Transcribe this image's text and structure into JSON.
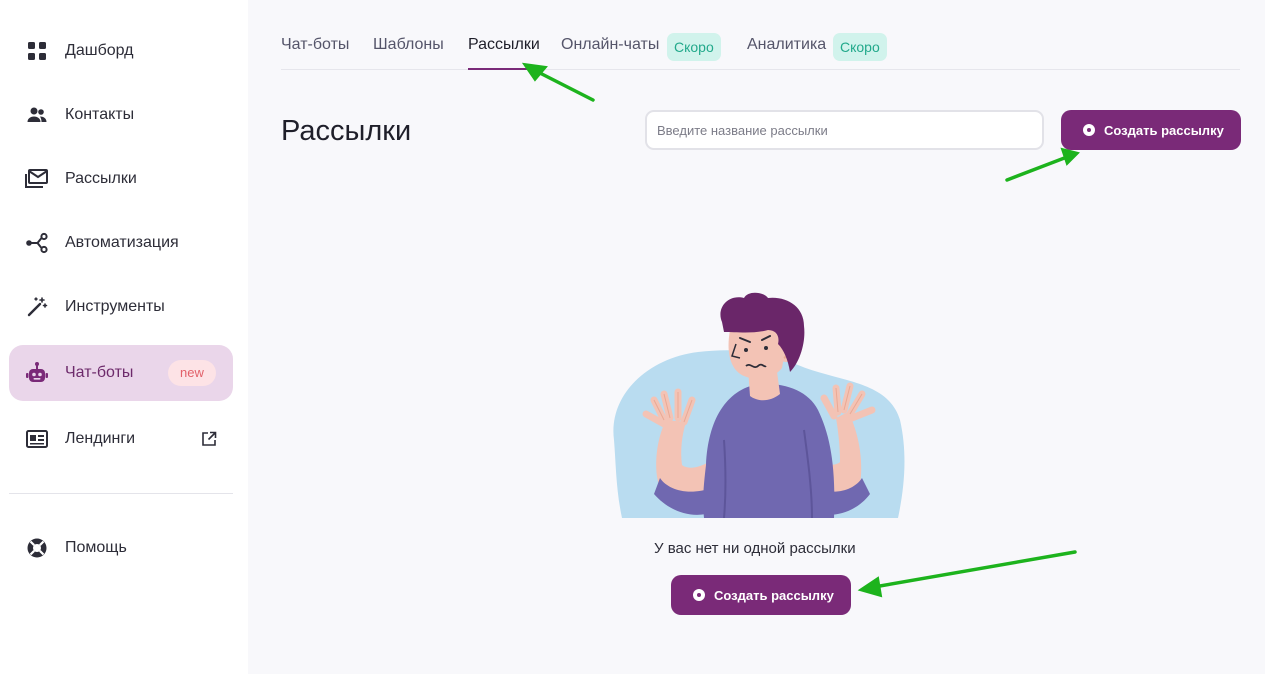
{
  "sidebar": {
    "items": [
      {
        "label": "Дашборд",
        "icon": "grid-icon"
      },
      {
        "label": "Контакты",
        "icon": "people-icon"
      },
      {
        "label": "Рассылки",
        "icon": "mail-stack-icon"
      },
      {
        "label": "Автоматизация",
        "icon": "share-nodes-icon"
      },
      {
        "label": "Инструменты",
        "icon": "magic-wand-icon"
      },
      {
        "label": "Чат-боты",
        "icon": "robot-icon",
        "badge": "new",
        "active": true
      },
      {
        "label": "Лендинги",
        "icon": "landing-page-icon",
        "external_icon": "external-link-icon"
      }
    ],
    "help": {
      "label": "Помощь",
      "icon": "lifebuoy-icon"
    }
  },
  "tabs": [
    {
      "label": "Чат-боты"
    },
    {
      "label": "Шаблоны"
    },
    {
      "label": "Рассылки",
      "active": true
    },
    {
      "label": "Онлайн-чаты",
      "badge": "Скоро"
    },
    {
      "label": "Аналитика",
      "badge": "Скоро"
    }
  ],
  "page": {
    "title": "Рассылки",
    "search_placeholder": "Введите название рассылки",
    "create_button": "Создать рассылку"
  },
  "empty_state": {
    "text": "У вас нет ни одной рассылки",
    "button": "Создать рассылку"
  },
  "colors": {
    "brand": "#7a2a78",
    "active_nav_bg": "#ead6ea",
    "soon_badge_bg": "#d1f3ec",
    "soon_badge_text": "#22a98b",
    "new_badge_bg": "#fde3e6",
    "new_badge_text": "#e2616a",
    "annotation_arrow": "#1db31d"
  }
}
